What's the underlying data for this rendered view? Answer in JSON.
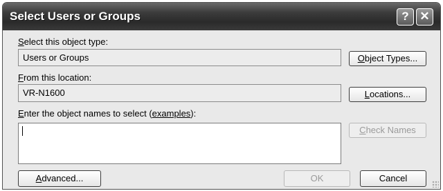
{
  "window": {
    "title": "Select Users or Groups",
    "help_glyph": "?",
    "close_glyph": "✕"
  },
  "object_type": {
    "label_accel": "S",
    "label_rest": "elect this object type:",
    "value": "Users or Groups",
    "button_accel": "O",
    "button_rest": "bject Types..."
  },
  "location": {
    "label_accel": "F",
    "label_rest": "rom this location:",
    "value": "VR-N1600",
    "button_accel": "L",
    "button_rest": "ocations..."
  },
  "names": {
    "label_accel": "E",
    "label_rest": "nter the object names to select (",
    "label_link": "examples",
    "label_end": "):",
    "value": "",
    "check_accel": "C",
    "check_rest": "heck Names",
    "check_enabled": false
  },
  "footer": {
    "advanced_accel": "A",
    "advanced_rest": "dvanced...",
    "ok_label": "OK",
    "ok_enabled": false,
    "cancel_label": "Cancel"
  },
  "icons": {
    "help": "help-icon",
    "close": "close-icon",
    "resize": "resize-grip-icon"
  }
}
